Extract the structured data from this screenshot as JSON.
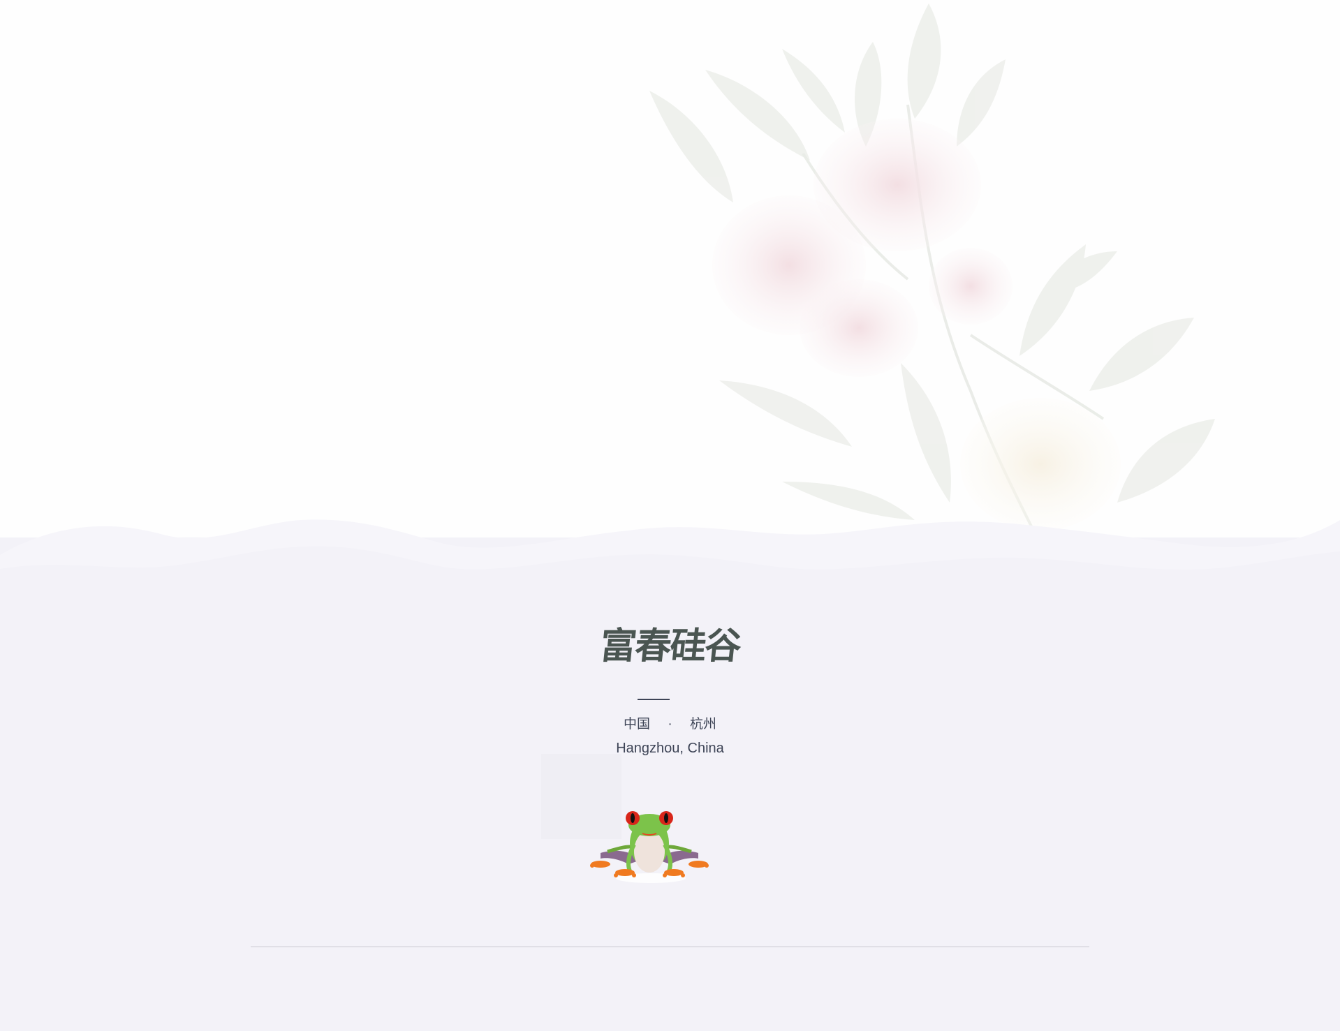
{
  "brand": {
    "title": "富春硅谷"
  },
  "location": {
    "country_cn": "中国",
    "separator": "·",
    "city_cn": "杭州",
    "english": "Hangzhou, China"
  },
  "colors": {
    "background_top": "#fefefe",
    "background_bottom": "#f3f2f8",
    "title_color": "#4a5551",
    "text_color": "#3d4456",
    "rule_color": "#c9c8cf"
  },
  "icons": {
    "mascot": "red-eyed-tree-frog",
    "decoration": "peony-watercolor"
  }
}
